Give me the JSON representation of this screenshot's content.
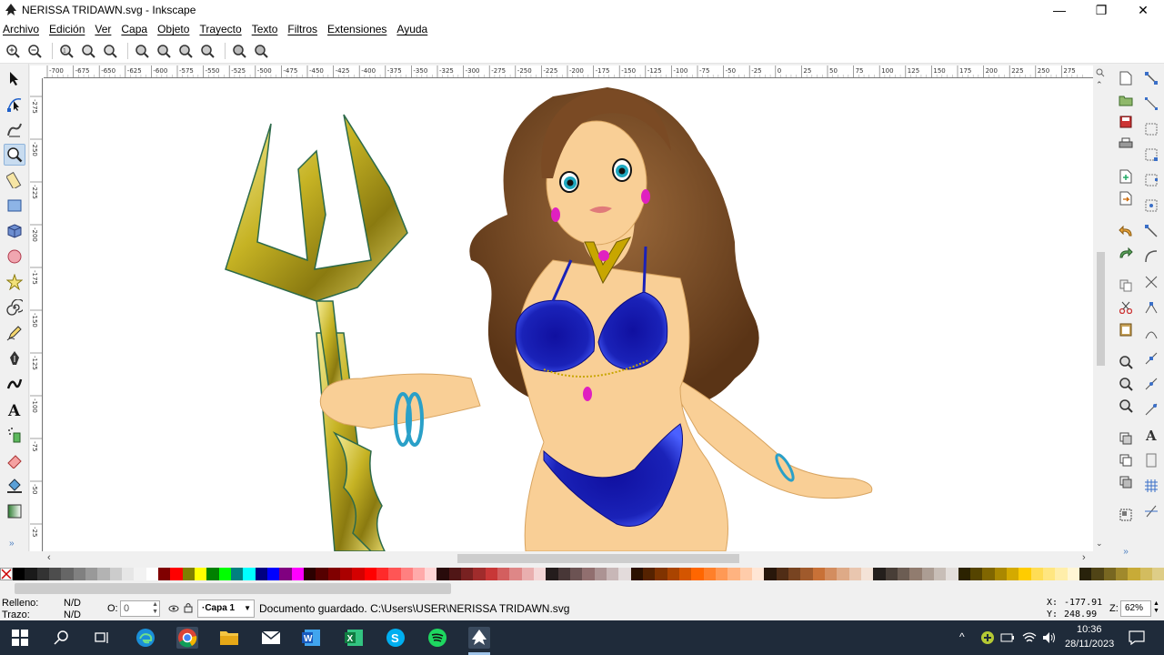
{
  "window": {
    "title": "NERISSA TRIDAWN.svg - Inkscape",
    "minimize": "—",
    "maximize": "❐",
    "close": "✕"
  },
  "menu": [
    "Archivo",
    "Edición",
    "Ver",
    "Capa",
    "Objeto",
    "Trayecto",
    "Texto",
    "Filtros",
    "Extensiones",
    "Ayuda"
  ],
  "ruler": {
    "h_ticks": [
      "-700",
      "-675",
      "-650",
      "-625",
      "-600",
      "-575",
      "-550",
      "-525",
      "-500",
      "-475",
      "-450",
      "-425",
      "-400",
      "-375",
      "-350",
      "-325",
      "-300",
      "-275",
      "-250",
      "-225",
      "-200",
      "-175",
      "-150",
      "-125",
      "-100",
      "-75",
      "-50",
      "-25",
      "0",
      "25",
      "50",
      "75",
      "100",
      "125",
      "150",
      "175",
      "200",
      "225",
      "250",
      "275"
    ],
    "v_ticks": [
      "-275",
      "-250",
      "-225",
      "-200",
      "-175",
      "-150",
      "-125",
      "-100",
      "-75",
      "-50",
      "-25"
    ]
  },
  "tools": [
    {
      "id": "selector",
      "icon": "arrow-select-icon"
    },
    {
      "id": "node",
      "icon": "node-edit-icon"
    },
    {
      "id": "tweak",
      "icon": "tweak-icon"
    },
    {
      "id": "zoom",
      "icon": "zoom-tool-icon",
      "active": true
    },
    {
      "id": "measure",
      "icon": "measure-icon"
    },
    {
      "id": "rect",
      "icon": "rectangle-icon"
    },
    {
      "id": "box3d",
      "icon": "box3d-icon"
    },
    {
      "id": "ellipse",
      "icon": "ellipse-icon"
    },
    {
      "id": "star",
      "icon": "star-icon"
    },
    {
      "id": "spiral",
      "icon": "spiral-icon"
    },
    {
      "id": "pencil",
      "icon": "pencil-icon"
    },
    {
      "id": "pen",
      "icon": "pen-icon"
    },
    {
      "id": "calligraphy",
      "icon": "calligraphy-icon"
    },
    {
      "id": "text",
      "icon": "text-tool-icon"
    },
    {
      "id": "spray",
      "icon": "spray-icon"
    },
    {
      "id": "eraser",
      "icon": "eraser-icon"
    },
    {
      "id": "bucket",
      "icon": "paint-bucket-icon"
    },
    {
      "id": "gradient",
      "icon": "gradient-icon"
    }
  ],
  "palette": [
    "#000000",
    "#1a1a1a",
    "#333333",
    "#4d4d4d",
    "#666666",
    "#808080",
    "#999999",
    "#b3b3b3",
    "#cccccc",
    "#e6e6e6",
    "#f2f2f2",
    "#ffffff",
    "#800000",
    "#ff0000",
    "#808000",
    "#ffff00",
    "#008000",
    "#00ff00",
    "#008080",
    "#00ffff",
    "#000080",
    "#0000ff",
    "#800080",
    "#ff00ff",
    "#2b0000",
    "#550000",
    "#800000",
    "#aa0000",
    "#d40000",
    "#ff0000",
    "#ff2a2a",
    "#ff5555",
    "#ff8080",
    "#ffaaaa",
    "#ffd5d5",
    "#280b0b",
    "#501616",
    "#782121",
    "#a02c2c",
    "#c83737",
    "#d35f5f",
    "#de8787",
    "#e9afaf",
    "#f4d7d7",
    "#241c1c",
    "#483737",
    "#6c5353",
    "#916f6f",
    "#ac9393",
    "#c8b7b7",
    "#e3dbdb",
    "#2b1100",
    "#552200",
    "#803300",
    "#aa4400",
    "#d45500",
    "#ff6600",
    "#ff7f2a",
    "#ff9955",
    "#ffb380",
    "#ffccaa",
    "#ffe6d5",
    "#28170b",
    "#502d16",
    "#784421",
    "#a05a2c",
    "#c87137",
    "#d38d5f",
    "#deaa87",
    "#e9c6af",
    "#f4e3d7",
    "#241f1c",
    "#483e37",
    "#6c5d53",
    "#917c6f",
    "#ac9d93",
    "#c8beb7",
    "#e3dedb",
    "#2b2200",
    "#554400",
    "#806600",
    "#aa8800",
    "#d4aa00",
    "#ffcc00",
    "#ffdd55",
    "#ffe680",
    "#ffeeaa",
    "#fff6d5",
    "#28220b",
    "#504416",
    "#786721",
    "#a0892c",
    "#c8ab37",
    "#d3bc5f",
    "#decd87"
  ],
  "status": {
    "fill_label": "Relleno:",
    "fill_value": "N/D",
    "stroke_label": "Trazo:",
    "stroke_value": "N/D",
    "opacity_label": "O:",
    "opacity_value": "0",
    "layer": "·Capa 1",
    "message": "Documento guardado. C:\\Users\\USER\\NERISSA TRIDAWN.svg",
    "x_label": "X:",
    "x_value": "-177.91",
    "y_label": "Y:",
    "y_value": "248.99",
    "zoom_label": "Z:",
    "zoom_value": "62%"
  },
  "taskbar": {
    "time": "10:36",
    "date": "28/11/2023"
  },
  "colors": {
    "accent": "#0078d7",
    "skin": "#f9cf96",
    "hair": "#7a4a24",
    "bikini": "#1a22b8",
    "trident": "#c8b225"
  }
}
